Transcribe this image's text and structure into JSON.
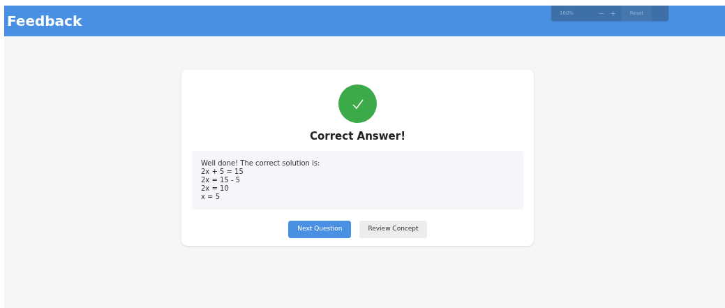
{
  "header": {
    "title": "Feedback"
  },
  "zoom_controls": {
    "level_text": "100%",
    "zoom_out": "−",
    "zoom_in": "+",
    "reset": "Reset"
  },
  "card": {
    "title": "Correct Answer!",
    "explanation": [
      "Well done! The correct solution is:",
      "2x + 5 = 15",
      "2x = 15 - 5",
      "2x = 10",
      "x = 5"
    ],
    "buttons": [
      {
        "label": "Next Question",
        "kind": "primary"
      },
      {
        "label": "Review Concept",
        "kind": "secondary"
      }
    ]
  }
}
